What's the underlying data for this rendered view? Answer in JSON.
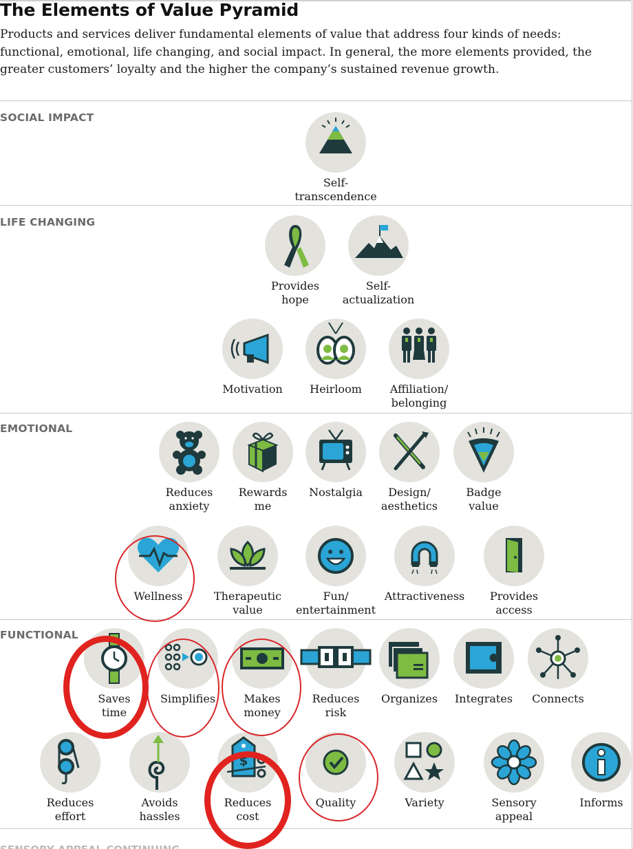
{
  "title": "The Elements of Value Pyramid",
  "intro": "Products and services deliver fundamental elements of value that address four kinds of needs: functional, emotional, life changing, and social impact. In general, the more elements provided, the greater customers’ loyalty and the higher the company’s sustained revenue growth.",
  "sections": {
    "social": "SOCIAL IMPACT",
    "life": "LIFE CHANGING",
    "emotional": "EMOTIONAL",
    "functional": "FUNCTIONAL",
    "next": "SENSORY APPEAL CONTINUING"
  },
  "elements": {
    "self_transcendence": {
      "label": "Self-\ntranscendence",
      "icon": "mountain-sun-icon"
    },
    "provides_hope": {
      "label": "Provides\nhope",
      "icon": "ribbon-icon"
    },
    "self_actualization": {
      "label": "Self-\nactualization",
      "icon": "mountain-flag-icon"
    },
    "motivation": {
      "label": "Motivation",
      "icon": "megaphone-icon"
    },
    "heirloom": {
      "label": "Heirloom",
      "icon": "portraits-icon"
    },
    "affiliation": {
      "label": "Affiliation/\nbelonging",
      "icon": "people-group-icon"
    },
    "reduces_anxiety": {
      "label": "Reduces\nanxiety",
      "icon": "teddy-bear-icon"
    },
    "rewards_me": {
      "label": "Rewards\nme",
      "icon": "gift-icon"
    },
    "nostalgia": {
      "label": "Nostalgia",
      "icon": "tv-icon"
    },
    "design": {
      "label": "Design/\naesthetics",
      "icon": "pencil-brush-icon"
    },
    "badge_value": {
      "label": "Badge\nvalue",
      "icon": "badge-icon"
    },
    "wellness": {
      "label": "Wellness",
      "icon": "heart-pulse-icon"
    },
    "therapeutic": {
      "label": "Therapeutic\nvalue",
      "icon": "lotus-icon"
    },
    "fun": {
      "label": "Fun/\nentertainment",
      "icon": "smiley-icon"
    },
    "attractiveness": {
      "label": "Attractiveness",
      "icon": "magnet-icon"
    },
    "provides_access": {
      "label": "Provides\naccess",
      "icon": "door-icon"
    },
    "saves_time": {
      "label": "Saves\ntime",
      "icon": "watch-icon"
    },
    "simplifies": {
      "label": "Simplifies",
      "icon": "dots-target-icon"
    },
    "makes_money": {
      "label": "Makes\nmoney",
      "icon": "banknote-icon"
    },
    "reduces_risk": {
      "label": "Reduces\nrisk",
      "icon": "seatbelt-icon"
    },
    "organizes": {
      "label": "Organizes",
      "icon": "folders-icon"
    },
    "integrates": {
      "label": "Integrates",
      "icon": "puzzle-icon"
    },
    "connects": {
      "label": "Connects",
      "icon": "network-hub-icon"
    },
    "reduces_effort": {
      "label": "Reduces\neffort",
      "icon": "pulley-icon"
    },
    "avoids_hassles": {
      "label": "Avoids\nhassles",
      "icon": "spiral-arrow-icon"
    },
    "reduces_cost": {
      "label": "Reduces\ncost",
      "icon": "price-tag-icon"
    },
    "quality": {
      "label": "Quality",
      "icon": "checkmark-icon"
    },
    "variety": {
      "label": "Variety",
      "icon": "shapes-icon"
    },
    "sensory_appeal": {
      "label": "Sensory\nappeal",
      "icon": "flower-icon"
    },
    "informs": {
      "label": "Informs",
      "icon": "info-icon"
    }
  },
  "colors": {
    "accent_green": "#7dbb42",
    "icon_dark": "#1f3a3d",
    "accent_blue": "#2aa5d6",
    "circle_bg": "#e3e2dd",
    "highlight_red": "#e0231f"
  }
}
